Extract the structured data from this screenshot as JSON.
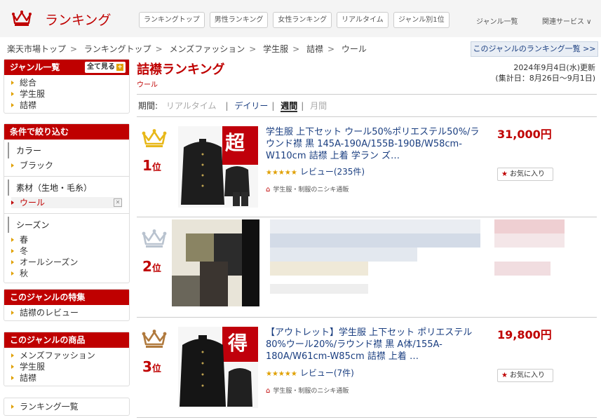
{
  "header": {
    "logo_text": "ランキング",
    "nav": [
      "ランキングトップ",
      "男性ランキング",
      "女性ランキング",
      "リアルタイム",
      "ジャンル別1位"
    ],
    "genre_list": "ジャンル一覧",
    "related": "関連サービス ∨"
  },
  "breadcrumb": [
    "楽天市場トップ",
    "ランキングトップ",
    "メンズファッション",
    "学生服",
    "詰襟",
    "ウール"
  ],
  "genre_rank_button": "このジャンルのランキング一覧 >>",
  "sidebar": {
    "genre": {
      "title": "ジャンル一覧",
      "all_button": "全て見る",
      "items": [
        "総合",
        "学生服",
        "詰襟"
      ]
    },
    "filter": {
      "title": "条件で絞り込む",
      "color_title": "カラー",
      "color_items": [
        "ブラック"
      ],
      "material_title": "素材（生地・毛糸）",
      "material_items": [
        "ウール"
      ],
      "season_title": "シーズン",
      "season_items": [
        "春",
        "冬",
        "オールシーズン",
        "秋"
      ]
    },
    "feature": {
      "title": "このジャンルの特集",
      "items": [
        "詰襟のレビュー"
      ]
    },
    "products": {
      "title": "このジャンルの商品",
      "items": [
        "メンズファッション",
        "学生服",
        "詰襟"
      ]
    },
    "ranking_list": "ランキング一覧"
  },
  "main": {
    "title": "詰襟ランキング",
    "subgenre": "ウール",
    "updated": "2024年9月4日(水)更新",
    "period_range": "(集計日：8月26日～9月1日)",
    "period_label": "期間:",
    "periods": [
      "リアルタイム",
      "デイリー",
      "週間",
      "月間"
    ],
    "items": [
      {
        "rank": "1",
        "rank_suffix": "位",
        "title": "学生服 上下セット ウール50%ポリエステル50%/ラウンド襟 黒 145A-190A/155B-190B/W58cm-W110cm 詰襟 上着 学ラン ズ…",
        "price": "31,000円",
        "stars": "★★★★★",
        "reviews": "レビュー(235件)",
        "shop": "学生服・制服のニシキ通販",
        "fav": "お気に入り",
        "thumb_badge": "超"
      },
      {
        "rank": "2",
        "rank_suffix": "位"
      },
      {
        "rank": "3",
        "rank_suffix": "位",
        "title": "【アウトレット】学生服 上下セット ポリエステル80%ウール20%/ラウンド襟 黒 A体/155A-180A/W61cm-W85cm 詰襟 上着 …",
        "price": "19,800円",
        "stars": "★★★★★",
        "reviews": "レビュー(7件)",
        "shop": "学生服・制服のニシキ通販",
        "fav": "お気に入り",
        "thumb_badge": "得"
      }
    ]
  },
  "colors": {
    "accent": "#bf0000",
    "gold": "#e8b81a",
    "silver": "#b9c3cf",
    "bronze": "#b07a3e"
  }
}
